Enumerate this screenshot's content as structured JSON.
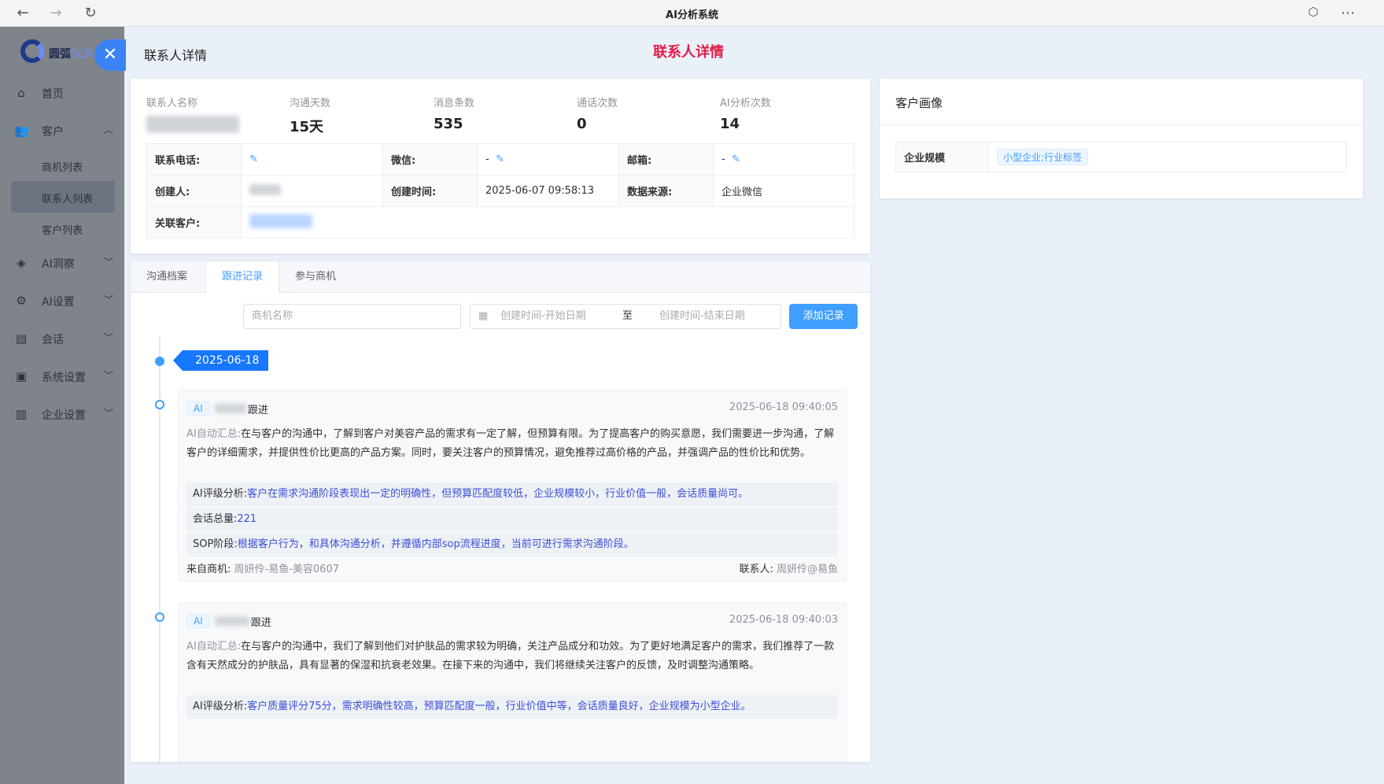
{
  "browser": {
    "title": "AI分析系统"
  },
  "sidebar": {
    "logo_text": "圆弧",
    "logo_suffix": "SCR",
    "items": [
      {
        "label": "首页",
        "icon": "home-icon"
      },
      {
        "label": "客户",
        "icon": "users-icon"
      },
      {
        "label": "AI洞察",
        "icon": "insight-icon"
      },
      {
        "label": "AI设置",
        "icon": "settings-icon"
      },
      {
        "label": "会话",
        "icon": "chat-icon"
      },
      {
        "label": "系统设置",
        "icon": "monitor-icon"
      },
      {
        "label": "企业设置",
        "icon": "building-icon"
      }
    ],
    "subitems": [
      "商机列表",
      "联系人列表",
      "客户列表"
    ]
  },
  "drawer": {
    "title": "联系人详情",
    "red_title": "联系人详情"
  },
  "stats": [
    {
      "label": "联系人名称",
      "value": ""
    },
    {
      "label": "沟通天数",
      "value": "15天"
    },
    {
      "label": "消息条数",
      "value": "535"
    },
    {
      "label": "通话次数",
      "value": "0"
    },
    {
      "label": "AI分析次数",
      "value": "14"
    }
  ],
  "details": {
    "phone_label": "联系电话:",
    "wechat_label": "微信:",
    "wechat_value": "-",
    "email_label": "邮箱:",
    "email_value": "-",
    "creator_label": "创建人:",
    "created_time_label": "创建时间:",
    "created_time_value": "2025-06-07 09:58:13",
    "source_label": "数据来源:",
    "source_value": "企业微信",
    "customer_label": "关联客户:"
  },
  "portrait": {
    "title": "客户画像",
    "scale_label": "企业规模",
    "scale_tag": "小型企业;行业标签"
  },
  "tabs": [
    "沟通档案",
    "跟进记录",
    "参与商机"
  ],
  "filters": {
    "opportunity_placeholder": "商机名称",
    "start_placeholder": "创建时间-开始日期",
    "separator": "至",
    "end_placeholder": "创建时间-结束日期",
    "add_button": "添加记录"
  },
  "timeline": {
    "date": "2025-06-18",
    "records": [
      {
        "tag": "AI",
        "suffix": "跟进",
        "time": "2025-06-18 09:40:05",
        "summary_label": "AI自动汇总:",
        "summary": "在与客户的沟通中，了解到客户对美容产品的需求有一定了解，但预算有限。为了提高客户的购买意愿，我们需要进一步沟通，了解客户的详细需求，并提供性价比更高的产品方案。同时，要关注客户的预算情况，避免推荐过高价格的产品，并强调产品的性价比和优势。",
        "rating_label": "AI评级分析:",
        "rating": "客户在需求沟通阶段表现出一定的明确性，但预算匹配度较低，企业规模较小，行业价值一般，会话质量尚可。",
        "total_label": "会话总量:",
        "total": "221",
        "sop_label": "SOP阶段:",
        "sop": "根据客户行为，和具体沟通分析，并遵循内部sop流程进度，当前可进行需求沟通阶段。",
        "from_label": "来自商机:",
        "from": "周妍伶-易鱼-美容0607",
        "contact_label": "联系人:",
        "contact": "周妍伶@易鱼"
      },
      {
        "tag": "AI",
        "suffix": "跟进",
        "time": "2025-06-18 09:40:03",
        "summary_label": "AI自动汇总:",
        "summary": "在与客户的沟通中，我们了解到他们对护肤品的需求较为明确，关注产品成分和功效。为了更好地满足客户的需求，我们推荐了一款含有天然成分的护肤品，具有显著的保湿和抗衰老效果。在接下来的沟通中，我们将继续关注客户的反馈，及时调整沟通策略。",
        "rating_label": "AI评级分析:",
        "rating": "客户质量评分75分，需求明确性较高，预算匹配度一般，行业价值中等，会话质量良好，企业规模为小型企业。"
      }
    ]
  }
}
